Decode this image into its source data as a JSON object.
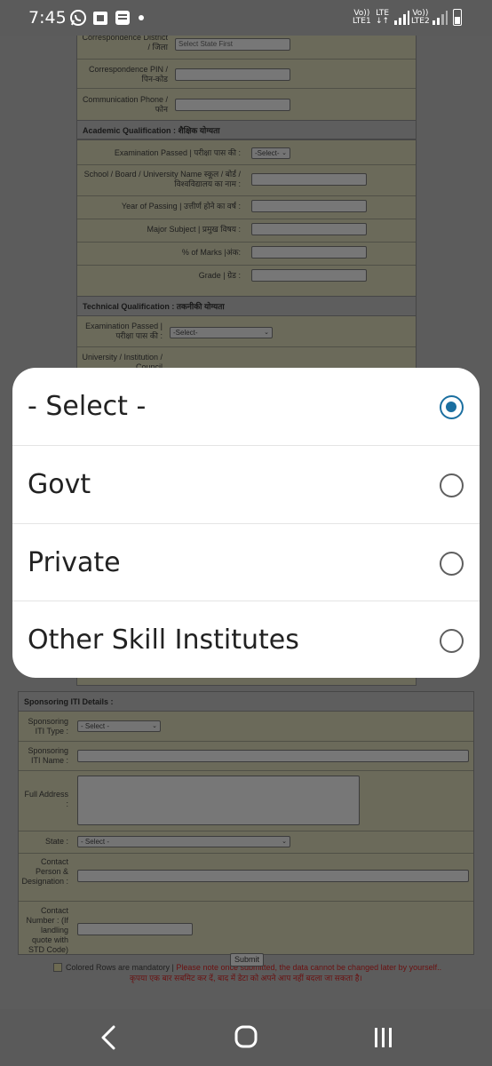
{
  "status_bar": {
    "time": "7:45",
    "sim1_top": "Vo))",
    "sim1_bottom": "LTE1",
    "sim1_net": "LTE",
    "sim2_top": "Vo))",
    "sim2_bottom": "LTE2",
    "icons": [
      "whatsapp-icon",
      "notification-app-icon",
      "news-app-icon",
      "signal-icon",
      "battery-icon"
    ]
  },
  "form": {
    "correspondence": {
      "district_label": "Correspondence District / जिला",
      "district_placeholder": "Select State First",
      "pin_label": "Correspondence PIN / पिन-कोड",
      "phone_label": "Communication Phone / फोन"
    },
    "academic": {
      "heading": "Academic Qualification : शैक्षिक योग्यता",
      "exam_label": "Examination Passed | परीक्षा पास की :",
      "exam_value": "-Select-",
      "school_label": "School / Board / University Name स्कूल / बोर्ड / विश्वविद्यालय का नाम :",
      "year_label": "Year of Passing | उत्तीर्ण होने का वर्ष :",
      "subject_label": "Major Subject | प्रमुख विषय :",
      "marks_label": "% of Marks |अंक:",
      "grade_label": "Grade | ग्रेड :"
    },
    "technical": {
      "heading": "Technical Qualification : तकनीकी योग्यता",
      "exam_label": "Examination Passed | परीक्षा पास की :",
      "exam_value": "-Select-",
      "university_label": "University / Institution / Council"
    },
    "sponsoring": {
      "heading": "Sponsoring ITI Details :",
      "type_label": "Sponsoring ITI Type :",
      "type_value": "- Select -",
      "name_label": "Sponsoring ITI Name :",
      "address_label": "Full Address :",
      "state_label": "State :",
      "state_value": "- Select -",
      "contact_label": "Contact Person & Designation :",
      "number_label": "Contact Number : (If landling quote with STD Code)"
    },
    "mandatory_note": "Colored Rows are mandatory |",
    "warning_note": "Please note once submitted, the data cannot be changed later by yourself..",
    "warning_note_hi": "कृपया एक बार सबमिट कर दें, बाद में डेटा को अपने आप नहीं बदला जा सकता है।",
    "submit_label": "Submit"
  },
  "popup": {
    "options": [
      {
        "label": "- Select -",
        "selected": true
      },
      {
        "label": "Govt",
        "selected": false
      },
      {
        "label": "Private",
        "selected": false
      },
      {
        "label": "Other Skill Institutes",
        "selected": false
      }
    ],
    "accent_color": "#1b6fa0"
  },
  "navbar": {
    "icons": [
      "back-icon",
      "home-icon",
      "recents-icon"
    ]
  }
}
